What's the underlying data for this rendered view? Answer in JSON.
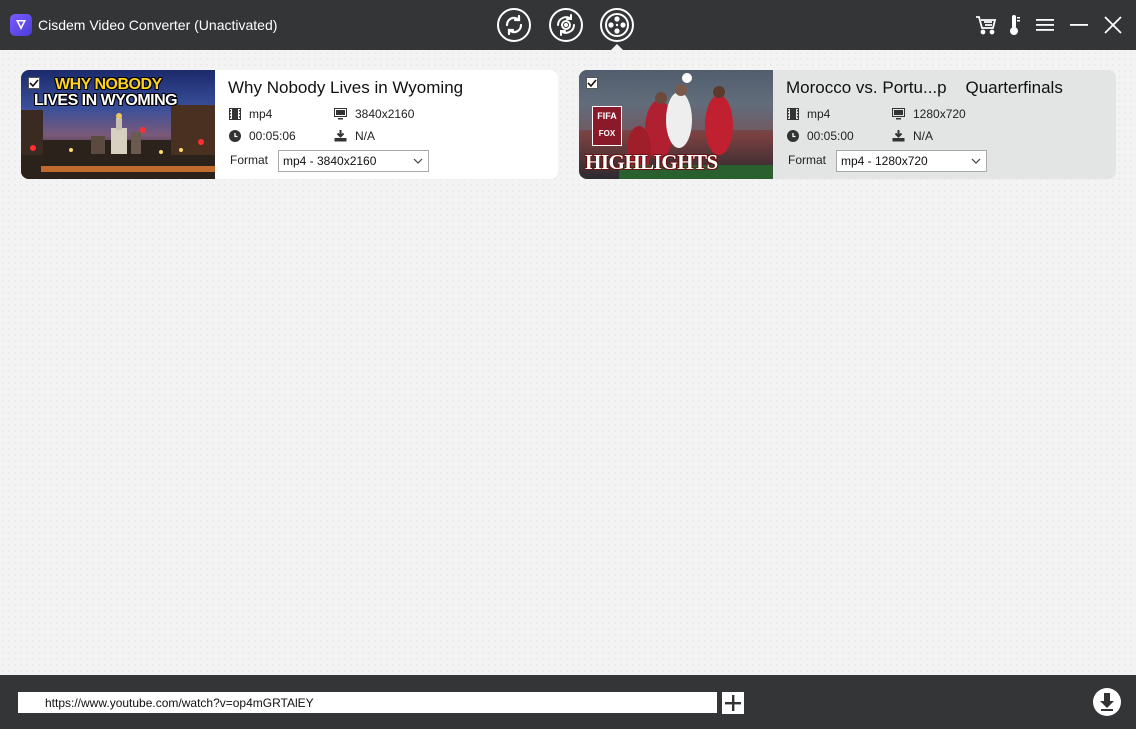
{
  "window": {
    "title": "Cisdem Video Converter (Unactivated)"
  },
  "toolbar": {
    "modes": [
      {
        "name": "convert",
        "icon": "convert-icon"
      },
      {
        "name": "rip",
        "icon": "rip-icon"
      },
      {
        "name": "download",
        "icon": "film-reel-icon",
        "active": true
      }
    ],
    "right_icons": [
      "cart-icon",
      "thermometer-icon",
      "menu-icon",
      "minimize-icon",
      "close-icon"
    ]
  },
  "videos": [
    {
      "title": "Why Nobody Lives in Wyoming",
      "container": "mp4",
      "resolution": "3840x2160",
      "duration": "00:05:06",
      "size": "N/A",
      "format_label": "Format",
      "format_value": "mp4 - 3840x2160",
      "checked": true,
      "thumb_text_line1": "WHY NOBODY",
      "thumb_text_line2": "LIVES IN WYOMING"
    },
    {
      "title": "Morocco vs. Portu...p    Quarterfinals",
      "container": "mp4",
      "resolution": "1280x720",
      "duration": "00:05:00",
      "size": "N/A",
      "format_label": "Format",
      "format_value": "mp4 - 1280x720",
      "checked": true,
      "thumb_badge_1": "FIFA",
      "thumb_badge_2": "FOX",
      "thumb_text": "HIGHLIGHTS"
    }
  ],
  "bottom": {
    "url_value": "https://www.youtube.com/watch?v=op4mGRTAlEY"
  },
  "colors": {
    "titlebar": "#343536",
    "background": "#f3f3f3",
    "card_selected": "#e3e4e4",
    "logo_accent": "#6a4cf0"
  }
}
